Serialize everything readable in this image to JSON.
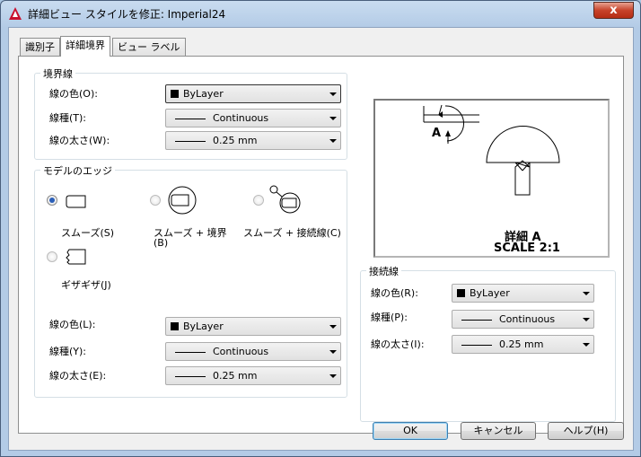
{
  "window": {
    "title": "詳細ビュー スタイルを修正: Imperial24",
    "close_label": "x"
  },
  "tabs": [
    {
      "label": "識別子"
    },
    {
      "label": "詳細境界"
    },
    {
      "label": "ビュー ラベル"
    }
  ],
  "active_tab": 1,
  "boundary": {
    "title": "境界線",
    "color_label": "線の色(O):",
    "color_value": "ByLayer",
    "linetype_label": "線種(T):",
    "linetype_value": "Continuous",
    "lineweight_label": "線の太さ(W):",
    "lineweight_value": "0.25 mm"
  },
  "model_edge": {
    "title": "モデルのエッジ",
    "options": [
      {
        "label": "スムーズ(S)",
        "selected": true
      },
      {
        "label": "スムーズ + 境界",
        "label2": "(B)",
        "selected": false
      },
      {
        "label": "スムーズ + 接続線(C)",
        "selected": false
      },
      {
        "label": "ギザギザ(J)",
        "selected": false
      }
    ],
    "color_label": "線の色(L):",
    "color_value": "ByLayer",
    "linetype_label": "線種(Y):",
    "linetype_value": "Continuous",
    "lineweight_label": "線の太さ(E):",
    "lineweight_value": "0.25 mm"
  },
  "preview": {
    "marker_label": "A",
    "caption_line1": "詳細 A",
    "caption_line2": "SCALE 2:1"
  },
  "connection": {
    "title": "接続線",
    "color_label": "線の色(R):",
    "color_value": "ByLayer",
    "linetype_label": "線種(P):",
    "linetype_value": "Continuous",
    "lineweight_label": "線の太さ(I):",
    "lineweight_value": "0.25 mm"
  },
  "buttons": {
    "ok": "OK",
    "cancel": "キャンセル",
    "help": "ヘルプ(H)"
  },
  "colors": {
    "accent_blue": "#2b5fb8",
    "close_red": "#c7432a"
  }
}
